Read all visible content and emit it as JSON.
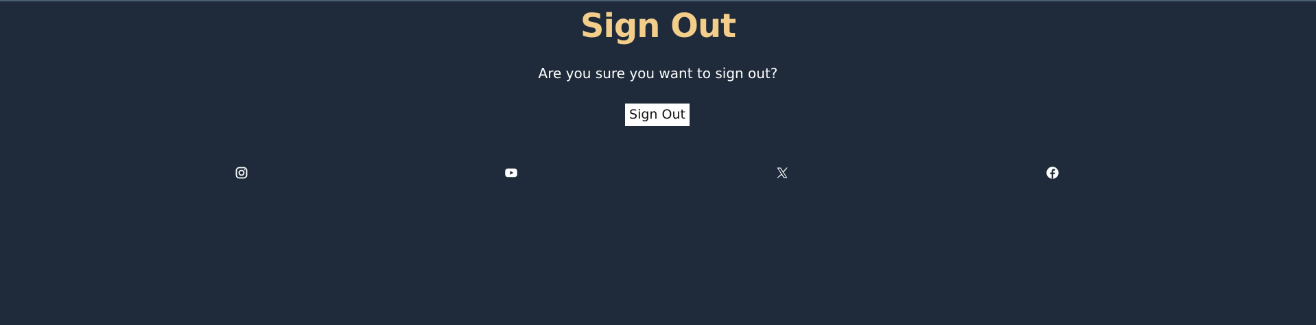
{
  "page": {
    "title": "Sign Out",
    "prompt": "Are you sure you want to sign out?",
    "button_label": "Sign Out"
  },
  "social_links": [
    {
      "name": "instagram",
      "icon": "instagram-icon"
    },
    {
      "name": "youtube",
      "icon": "youtube-icon"
    },
    {
      "name": "x",
      "icon": "x-icon"
    },
    {
      "name": "facebook",
      "icon": "facebook-icon"
    }
  ],
  "colors": {
    "background": "#1f2b3a",
    "title": "#f3cd8a",
    "text": "#ffffff",
    "button_background": "#ffffff",
    "button_text": "#111111"
  }
}
